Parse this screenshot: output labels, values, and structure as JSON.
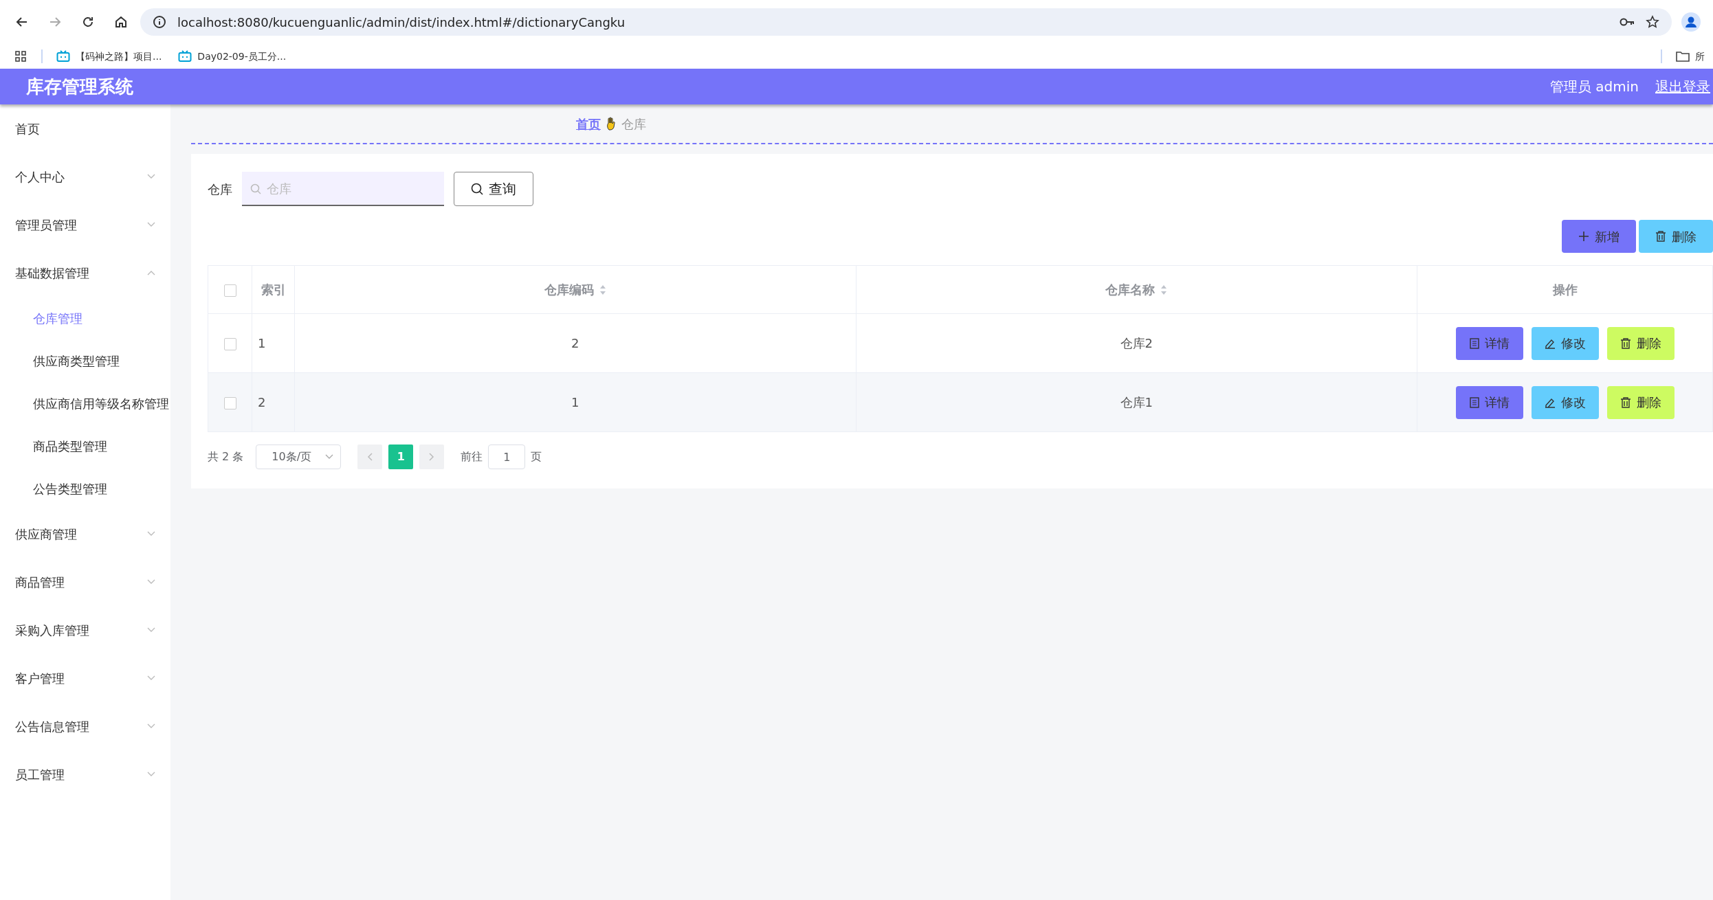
{
  "browser": {
    "url": "localhost:8080/kucuenguanlic/admin/dist/index.html#/dictionaryCangku",
    "back_disabled": false,
    "forward_disabled": true,
    "bookmarks": [
      "【码神之路】项目...",
      "Day02-09-员工分..."
    ],
    "folder_label": "所"
  },
  "header": {
    "title": "库存管理系统",
    "user": "管理员 admin",
    "logout": "退出登录"
  },
  "sidebar": {
    "items": [
      {
        "label": "首页",
        "kind": "link"
      },
      {
        "label": "个人中心",
        "kind": "group",
        "expanded": false
      },
      {
        "label": "管理员管理",
        "kind": "group",
        "expanded": false
      },
      {
        "label": "基础数据管理",
        "kind": "group",
        "expanded": true,
        "children": [
          {
            "label": "仓库管理",
            "selected": true
          },
          {
            "label": "供应商类型管理",
            "selected": false
          },
          {
            "label": "供应商信用等级名称管理",
            "selected": false
          },
          {
            "label": "商品类型管理",
            "selected": false
          },
          {
            "label": "公告类型管理",
            "selected": false
          }
        ]
      },
      {
        "label": "供应商管理",
        "kind": "group",
        "expanded": false
      },
      {
        "label": "商品管理",
        "kind": "group",
        "expanded": false
      },
      {
        "label": "采购入库管理",
        "kind": "group",
        "expanded": false
      },
      {
        "label": "客户管理",
        "kind": "group",
        "expanded": false
      },
      {
        "label": "公告信息管理",
        "kind": "group",
        "expanded": false
      },
      {
        "label": "员工管理",
        "kind": "group",
        "expanded": false
      }
    ]
  },
  "breadcrumb": [
    {
      "label": "首页",
      "current": false
    },
    {
      "label": "仓库",
      "current": true
    }
  ],
  "search": {
    "label": "仓库",
    "placeholder": "仓库",
    "button": "查询"
  },
  "toolbar": [
    {
      "label": "新增",
      "kind": "add"
    },
    {
      "label": "删除",
      "kind": "delete"
    }
  ],
  "table": {
    "all_checked": false,
    "columns": [
      {
        "label": "索引",
        "sortable": false
      },
      {
        "label": "仓库编码",
        "sortable": true
      },
      {
        "label": "仓库名称",
        "sortable": true
      },
      {
        "label": "操作",
        "sortable": false
      }
    ],
    "rows": [
      {
        "checked": false,
        "cells": [
          "1",
          "2",
          "仓库2"
        ],
        "actions": [
          {
            "label": "详情",
            "kind": "detail"
          },
          {
            "label": "修改",
            "kind": "edit"
          },
          {
            "label": "删除",
            "kind": "delete"
          }
        ]
      },
      {
        "checked": false,
        "cells": [
          "2",
          "1",
          "仓库1"
        ],
        "actions": [
          {
            "label": "详情",
            "kind": "detail"
          },
          {
            "label": "修改",
            "kind": "edit"
          },
          {
            "label": "删除",
            "kind": "delete"
          }
        ]
      }
    ]
  },
  "pagination": {
    "total": "共 2 条",
    "page_size": "10条/页",
    "pages": [
      {
        "label": "1",
        "selected": true
      }
    ],
    "goto_label": "前往",
    "goto_value": "1",
    "page_suffix": "页"
  }
}
